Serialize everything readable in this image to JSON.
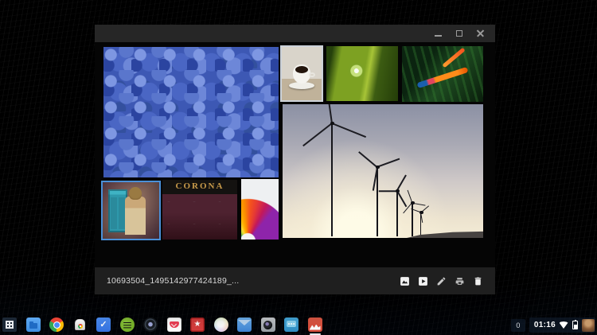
{
  "window": {
    "app": "Gallery",
    "controls": {
      "minimize": "minimize",
      "maximize": "maximize",
      "close": "close"
    },
    "gallery": {
      "corona_text": "CORONA",
      "items": [
        {
          "name": "photo-blue-stones",
          "label": "Blue pebbles",
          "selected": false
        },
        {
          "name": "photo-coffee-cup",
          "label": "Coffee cup",
          "selected": true
        },
        {
          "name": "photo-water-droplet-leaf",
          "label": "Water droplets on leaf",
          "selected": false
        },
        {
          "name": "photo-bird-of-paradise",
          "label": "Bird of paradise flower",
          "selected": false
        },
        {
          "name": "photo-wind-turbines",
          "label": "Wind turbines at sunset",
          "selected": false
        },
        {
          "name": "photo-costume-police-box",
          "label": "Costumed figure with police box",
          "selected": true
        },
        {
          "name": "photo-corona-typewriter",
          "label": "Corona typewriter",
          "selected": false
        },
        {
          "name": "photo-color-fan",
          "label": "Color swatch fan",
          "selected": false
        }
      ]
    },
    "footer": {
      "filename": "10693504_1495142977424189_...",
      "actions": [
        {
          "name": "mosaic-view-icon"
        },
        {
          "name": "slideshow-icon"
        },
        {
          "name": "edit-icon"
        },
        {
          "name": "print-icon"
        },
        {
          "name": "delete-icon"
        }
      ]
    }
  },
  "shelf": {
    "apps": [
      {
        "name": "app-launcher",
        "running": false
      },
      {
        "name": "files",
        "running": false
      },
      {
        "name": "chrome",
        "running": false
      },
      {
        "name": "chrome-web-store",
        "running": false
      },
      {
        "name": "inbox",
        "running": false
      },
      {
        "name": "spotify",
        "running": false
      },
      {
        "name": "lens-app",
        "running": false
      },
      {
        "name": "pocket",
        "running": false
      },
      {
        "name": "wunderlist",
        "running": false
      },
      {
        "name": "pastel-circle-app",
        "running": false
      },
      {
        "name": "mail",
        "running": false
      },
      {
        "name": "camera",
        "running": false
      },
      {
        "name": "messages",
        "running": false
      },
      {
        "name": "gallery",
        "running": true
      }
    ],
    "status": {
      "notification_count": "0",
      "time": "01:16"
    }
  }
}
